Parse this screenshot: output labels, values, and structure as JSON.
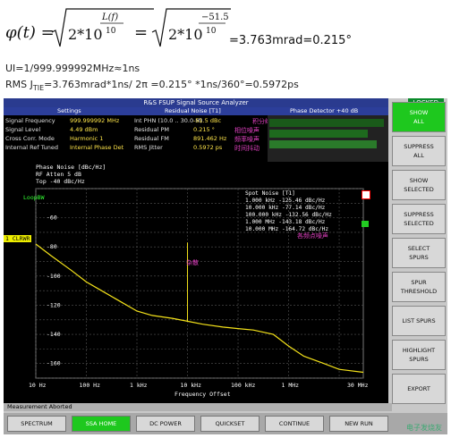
{
  "formula": {
    "lhs": "φ(t) =",
    "exp1": "L(f)",
    "exp1_den": "10",
    "base1": "2*10",
    "exp2": "−51.5",
    "exp2_den": "10",
    "base2": "2*10",
    "result": "=3.763mrad=0.215°"
  },
  "notes": {
    "ui_line": "UI=1/999.999992MHz≈1ns",
    "rms_prefix": "RMS J",
    "rms_sub": "TIE",
    "rms_rest": "=3.763mrad*1ns/ 2π =0.215° *1ns/360°=0.5972ps"
  },
  "instrument": {
    "title": "R&S FSUP Signal Source Analyzer",
    "locked": "LOCKED",
    "hdr_settings": "Settings",
    "hdr_residual": "Residual Noise [T1]",
    "hdr_phase_det": "Phase Detector +40 dB",
    "rows": [
      {
        "k": "Signal Frequency",
        "v1": "999.999992 MHz",
        "k2": "Int PHN (10.0 .. 30.0 M)",
        "v2": "-51.5 dBc"
      },
      {
        "k": "Signal Level",
        "v1": "4.49 dBm",
        "k2": "Residual PM",
        "v2": "0.215 °"
      },
      {
        "k": "Cross Corr. Mode",
        "v1": "Harmonic 1",
        "k2": "Residual FM",
        "v2": "891.462 Hz"
      },
      {
        "k": "Internal Ref Tuned",
        "v1": "Internal Phase Det",
        "k2": "RMS Jitter",
        "v2": "0.5972 ps"
      }
    ],
    "cn_labels": [
      "积分结果",
      "相位噪声",
      "频率噪声",
      "时间抖动"
    ],
    "plot_header": [
      "Phase Noise [dBc/Hz]",
      "RF Atten     5 dB",
      "Top -40 dBc/Hz"
    ],
    "loop_label": "LoopBW",
    "marker_label": "1 CLRWR",
    "y_ticks": [
      "-60",
      "-80",
      "-100",
      "-120",
      "-140",
      "-160"
    ],
    "x_ticks": [
      "10 Hz",
      "100 Hz",
      "1 kHz",
      "10 kHz",
      "100 kHz",
      "1 MHz",
      "30 MHz"
    ],
    "x_axis_label": "Frequency Offset",
    "legend_title": "Spot Noise   [T1]",
    "legend_rows": [
      "1.000 kHz   -125.46 dBc/Hz",
      "10.000 kHz  -77.14 dBc/Hz",
      "100.000 kHz -132.56 dBc/Hz",
      "1.000 MHz   -143.18 dBc/Hz",
      "10.000 MHz  -164.72 dBc/Hz"
    ],
    "cn_spot": "各频点噪声",
    "cn_spur": "杂散",
    "status": "Measurement Aborted",
    "softkeys": [
      {
        "l1": "SHOW",
        "l2": "ALL",
        "active": true
      },
      {
        "l1": "SUPPRESS",
        "l2": "ALL",
        "active": false
      },
      {
        "l1": "SHOW",
        "l2": "SELECTED",
        "active": false
      },
      {
        "l1": "SUPPRESS",
        "l2": "SELECTED",
        "active": false
      },
      {
        "l1": "SELECT",
        "l2": "SPURS",
        "active": false
      },
      {
        "l1": "SPUR",
        "l2": "THRESHOLD",
        "active": false
      },
      {
        "l1": "LIST SPURS",
        "l2": "",
        "active": false
      },
      {
        "l1": "HIGHLIGHT",
        "l2": "SPURS",
        "active": false
      },
      {
        "l1": "EXPORT",
        "l2": "",
        "active": false
      }
    ],
    "bottom_keys": [
      {
        "label": "SPECTRUM",
        "active": false
      },
      {
        "label": "SSA HOME",
        "active": true
      },
      {
        "label": "DC POWER",
        "active": false
      },
      {
        "label": "QUICKSET",
        "active": false
      },
      {
        "label": "CONTINUE",
        "active": false
      },
      {
        "label": "NEW RUN",
        "active": false
      }
    ],
    "watermark": "电子发烧友"
  },
  "chart_data": {
    "type": "line",
    "title": "",
    "xlabel": "Frequency Offset",
    "ylabel": "Phase Noise [dBc/Hz]",
    "x_scale": "log",
    "xlim": [
      10,
      30000000
    ],
    "ylim": [
      -170,
      -40
    ],
    "grid": true,
    "series": [
      {
        "x": [
          10,
          20,
          50,
          100,
          200,
          500,
          1000,
          2000,
          5000,
          10000,
          20000,
          50000,
          100000,
          200000,
          500000,
          1000000,
          2000000,
          5000000,
          10000000,
          30000000
        ],
        "y": [
          -78,
          -86,
          -96,
          -104,
          -110,
          -118,
          -124,
          -127,
          -129,
          -131,
          -133,
          -135,
          -136,
          -137,
          -140,
          -148,
          -155,
          -160,
          -164,
          -166
        ]
      }
    ],
    "spurs": [
      {
        "x": 10000,
        "y": -77
      }
    ]
  }
}
